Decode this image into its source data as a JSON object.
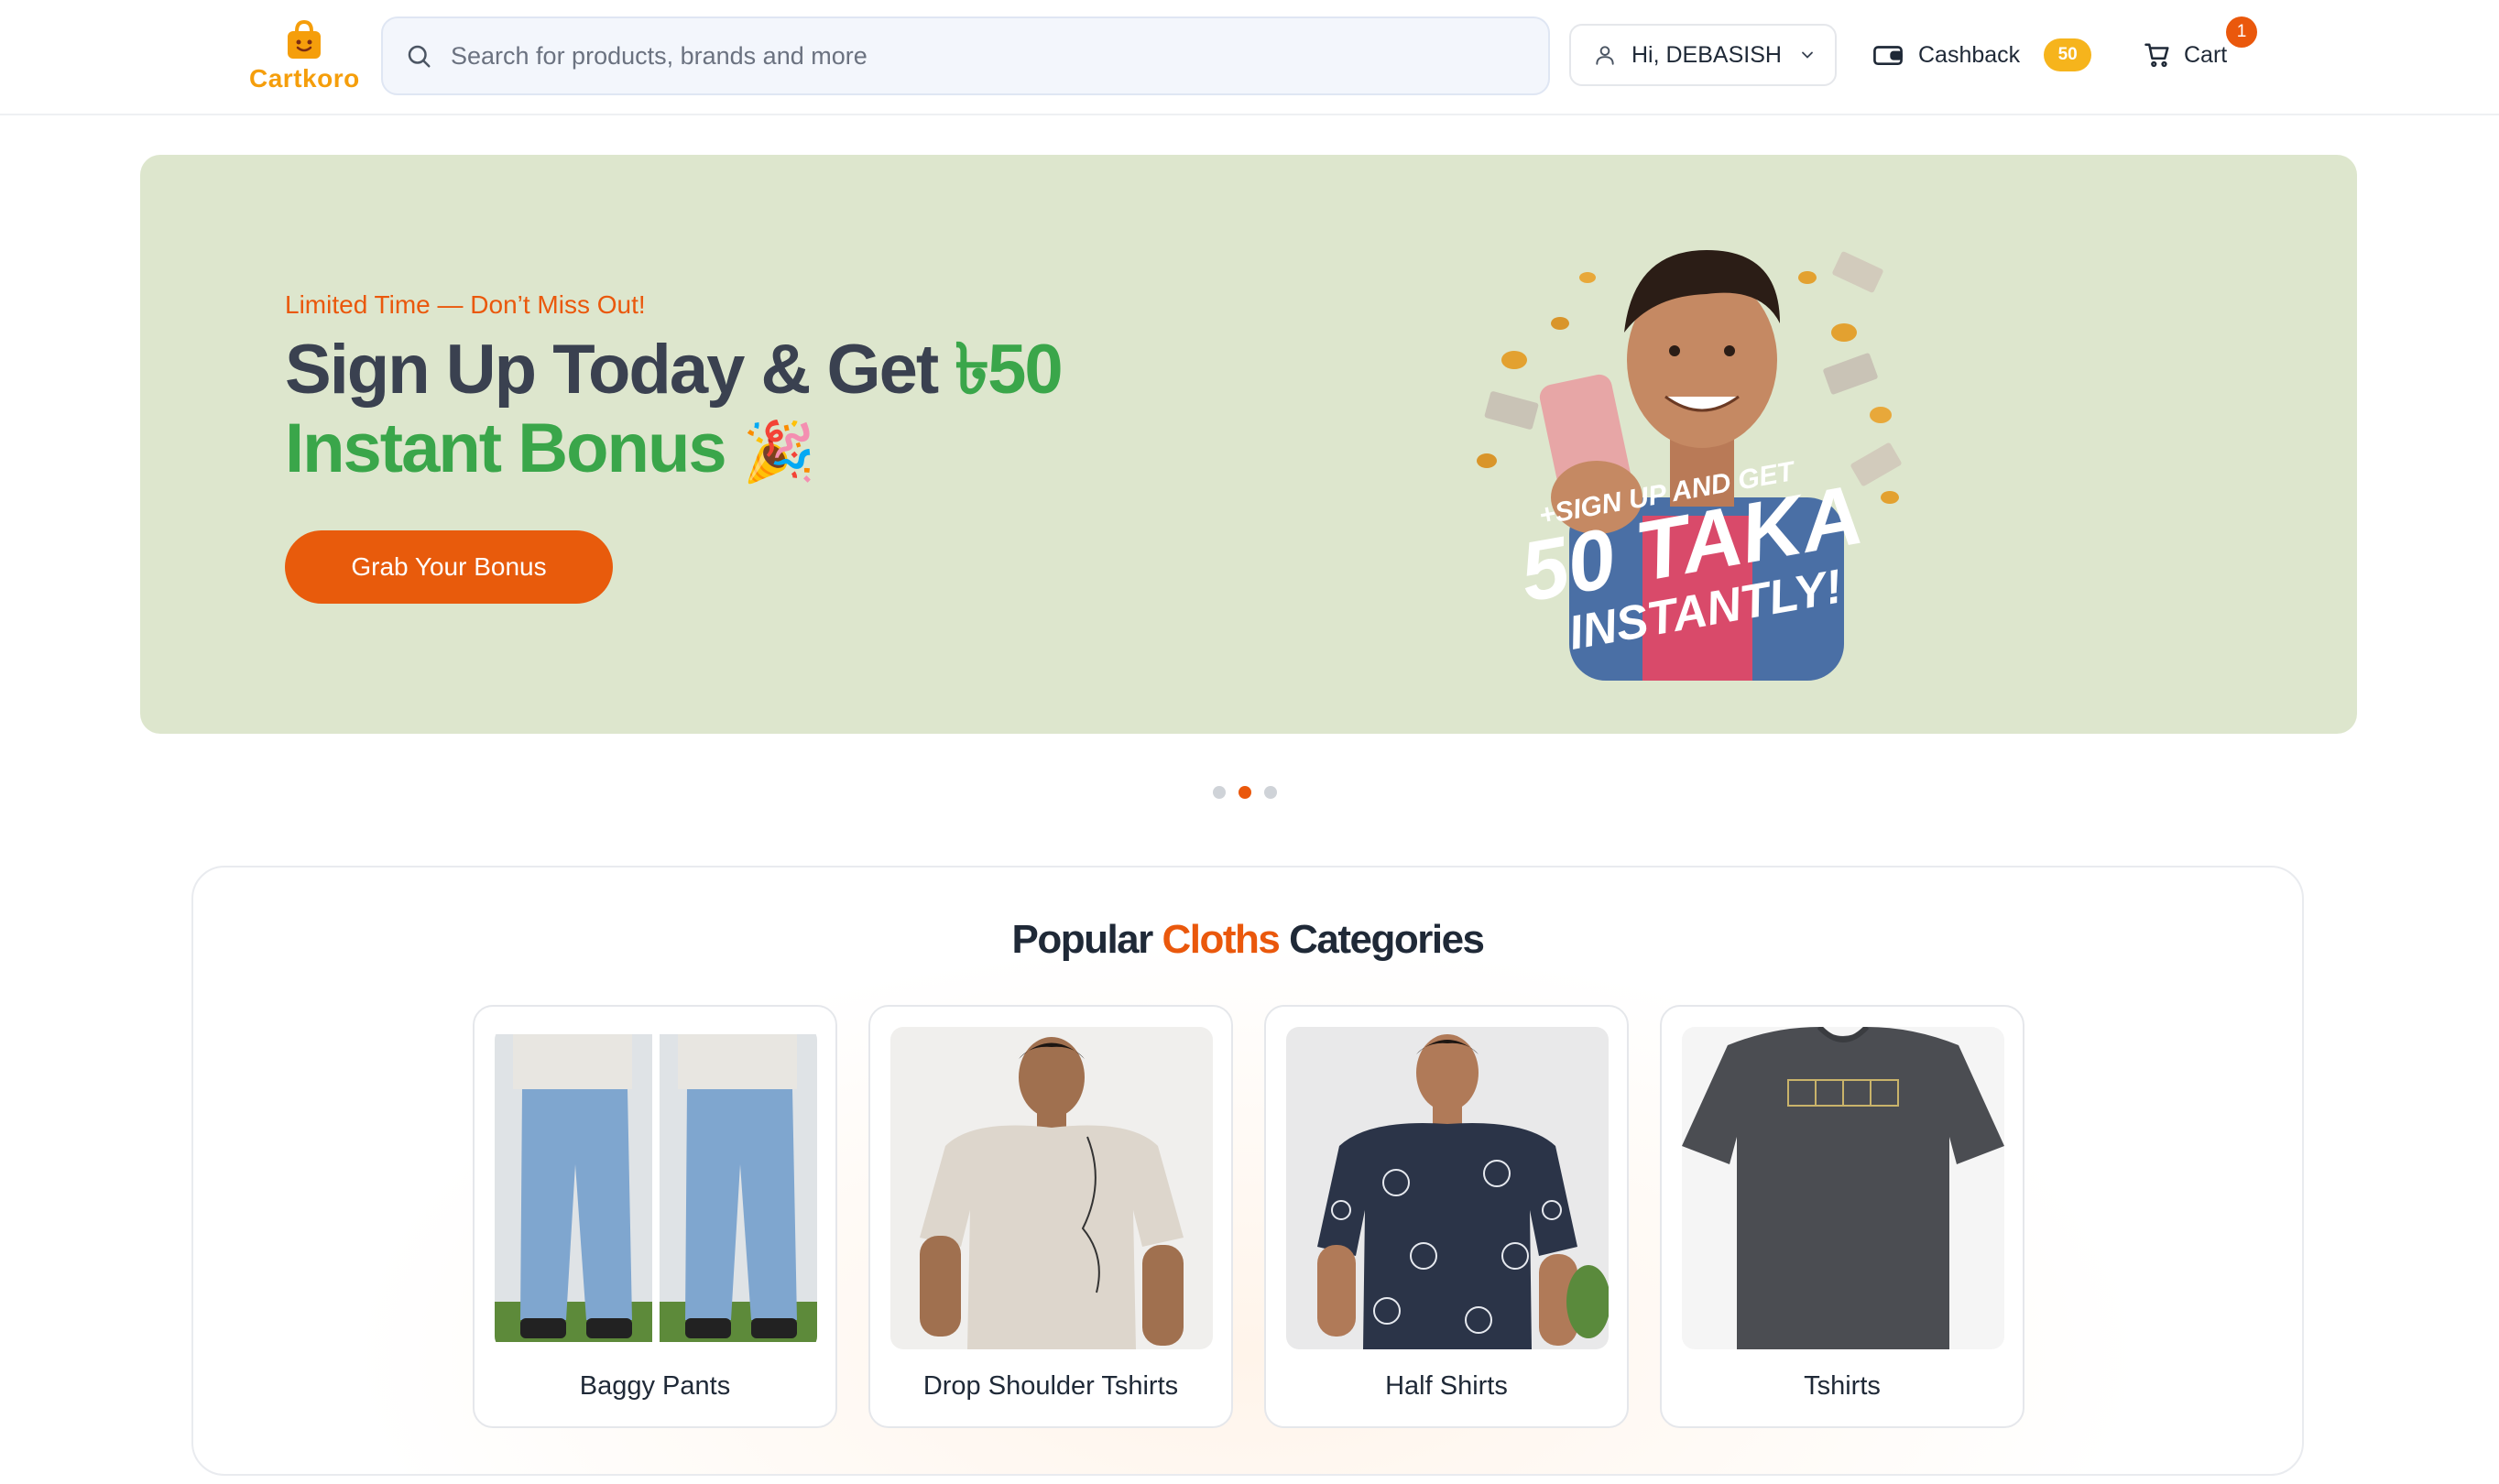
{
  "header": {
    "logo_text": "Cartkoro",
    "search_placeholder": "Search for products, brands and more",
    "user_greeting": "Hi, DEBASISH",
    "cashback_label": "Cashback",
    "cashback_amount": "50",
    "cart_label": "Cart",
    "cart_count": "1"
  },
  "hero": {
    "eyebrow": "Limited Time — Don’t Miss Out!",
    "title_part1": "Sign Up Today & Get ",
    "title_amount": "৳50",
    "title_part2": "Instant Bonus",
    "title_emoji": "🎉",
    "button_label": "Grab Your Bonus",
    "promo_line1": "+SIGN UP AND GET",
    "promo_line2": "50 TAKA",
    "promo_line3": "INSTANTLY!"
  },
  "carousel": {
    "total": 3,
    "active_index": 1
  },
  "categories": {
    "title_part1": "Popular ",
    "title_highlight": "Cloths",
    "title_part2": " Categories",
    "items": [
      {
        "name": "Baggy Pants"
      },
      {
        "name": "Drop Shoulder Tshirts"
      },
      {
        "name": "Half Shirts"
      },
      {
        "name": "Tshirts"
      }
    ]
  },
  "colors": {
    "accent": "#ea580c",
    "green": "#3aa64a",
    "banner_bg": "#dde6cd",
    "badge": "#f6b41c"
  }
}
